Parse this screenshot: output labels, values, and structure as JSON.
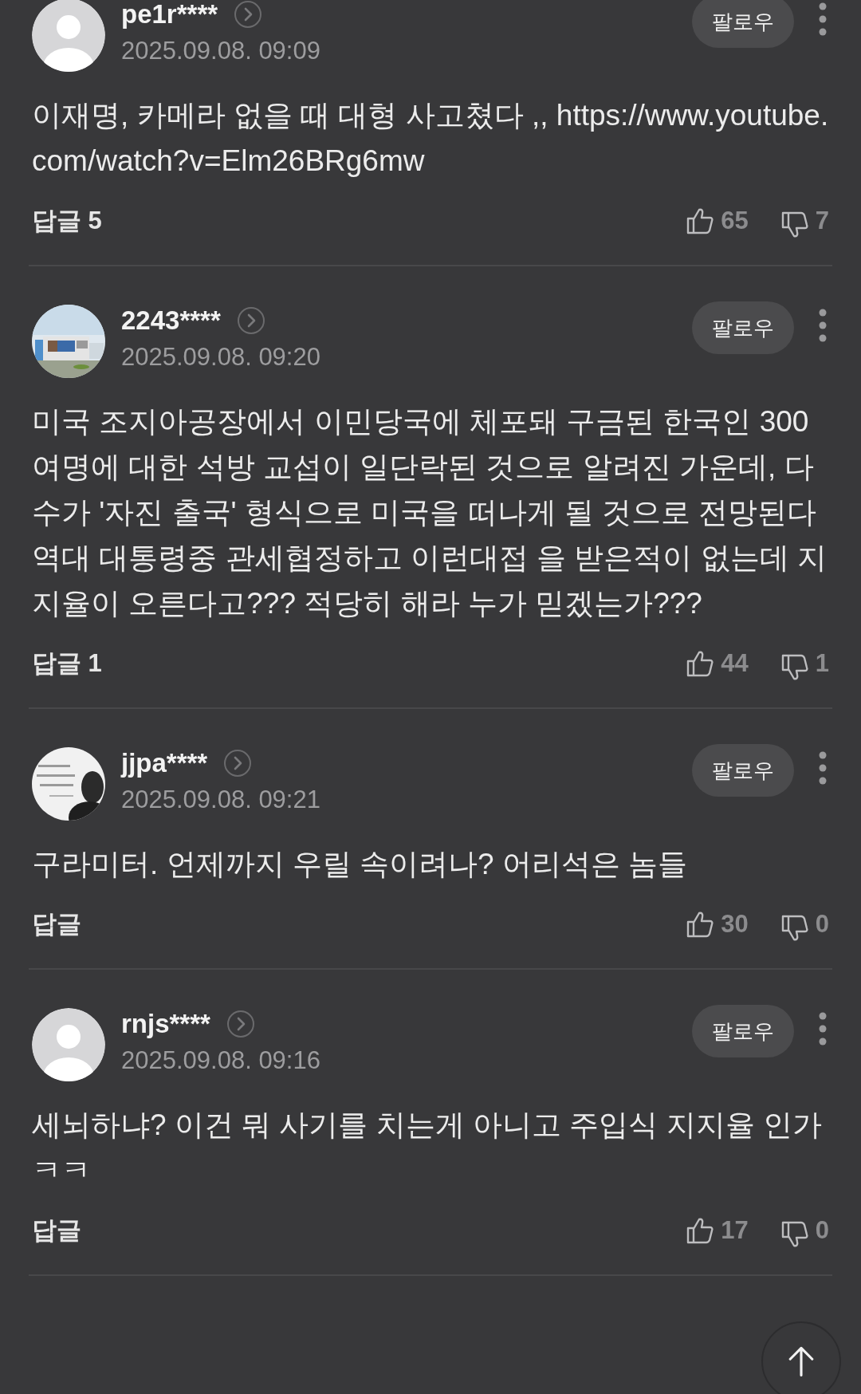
{
  "comments": [
    {
      "user": "pe1r****",
      "date": "2025.09.08. 09:09",
      "avatar": {
        "kind": "default"
      },
      "follow": "팔로우",
      "text": "이재명, 카메라 없을 때 대형 사고쳤다 ,, https://www.youtube.com/watch?v=Elm26BRg6mw",
      "reply": "답글 5",
      "likes": "65",
      "dislikes": "7"
    },
    {
      "user": "2243****",
      "date": "2025.09.08. 09:20",
      "avatar": {
        "kind": "building"
      },
      "follow": "팔로우",
      "text": "미국 조지아공장에서 이민당국에 체포돼 구금된 한국인 300여명에 대한 석방 교섭이 일단락된 것으로 알려진 가운데, 다수가 '자진 출국' 형식으로 미국을 떠나게 될 것으로 전망된다 역대 대통령중 관세협정하고 이런대접 을 받은적이 없는데 지지율이 오른다고??? 적당히 해라 누가 믿겠는가???",
      "reply": "답글 1",
      "likes": "44",
      "dislikes": "1"
    },
    {
      "user": "jjpa****",
      "date": "2025.09.08. 09:21",
      "avatar": {
        "kind": "portrait"
      },
      "follow": "팔로우",
      "text": "구라미터. 언제까지 우릴 속이려나? 어리석은 놈들",
      "reply": "답글",
      "likes": "30",
      "dislikes": "0"
    },
    {
      "user": "rnjs****",
      "date": "2025.09.08. 09:16",
      "avatar": {
        "kind": "default"
      },
      "follow": "팔로우",
      "text": "세뇌하냐? 이건 뭐 사기를 치는게 아니고 주입식 지지율 인가 ㅋㅋ",
      "reply": "답글",
      "likes": "17",
      "dislikes": "0"
    }
  ]
}
